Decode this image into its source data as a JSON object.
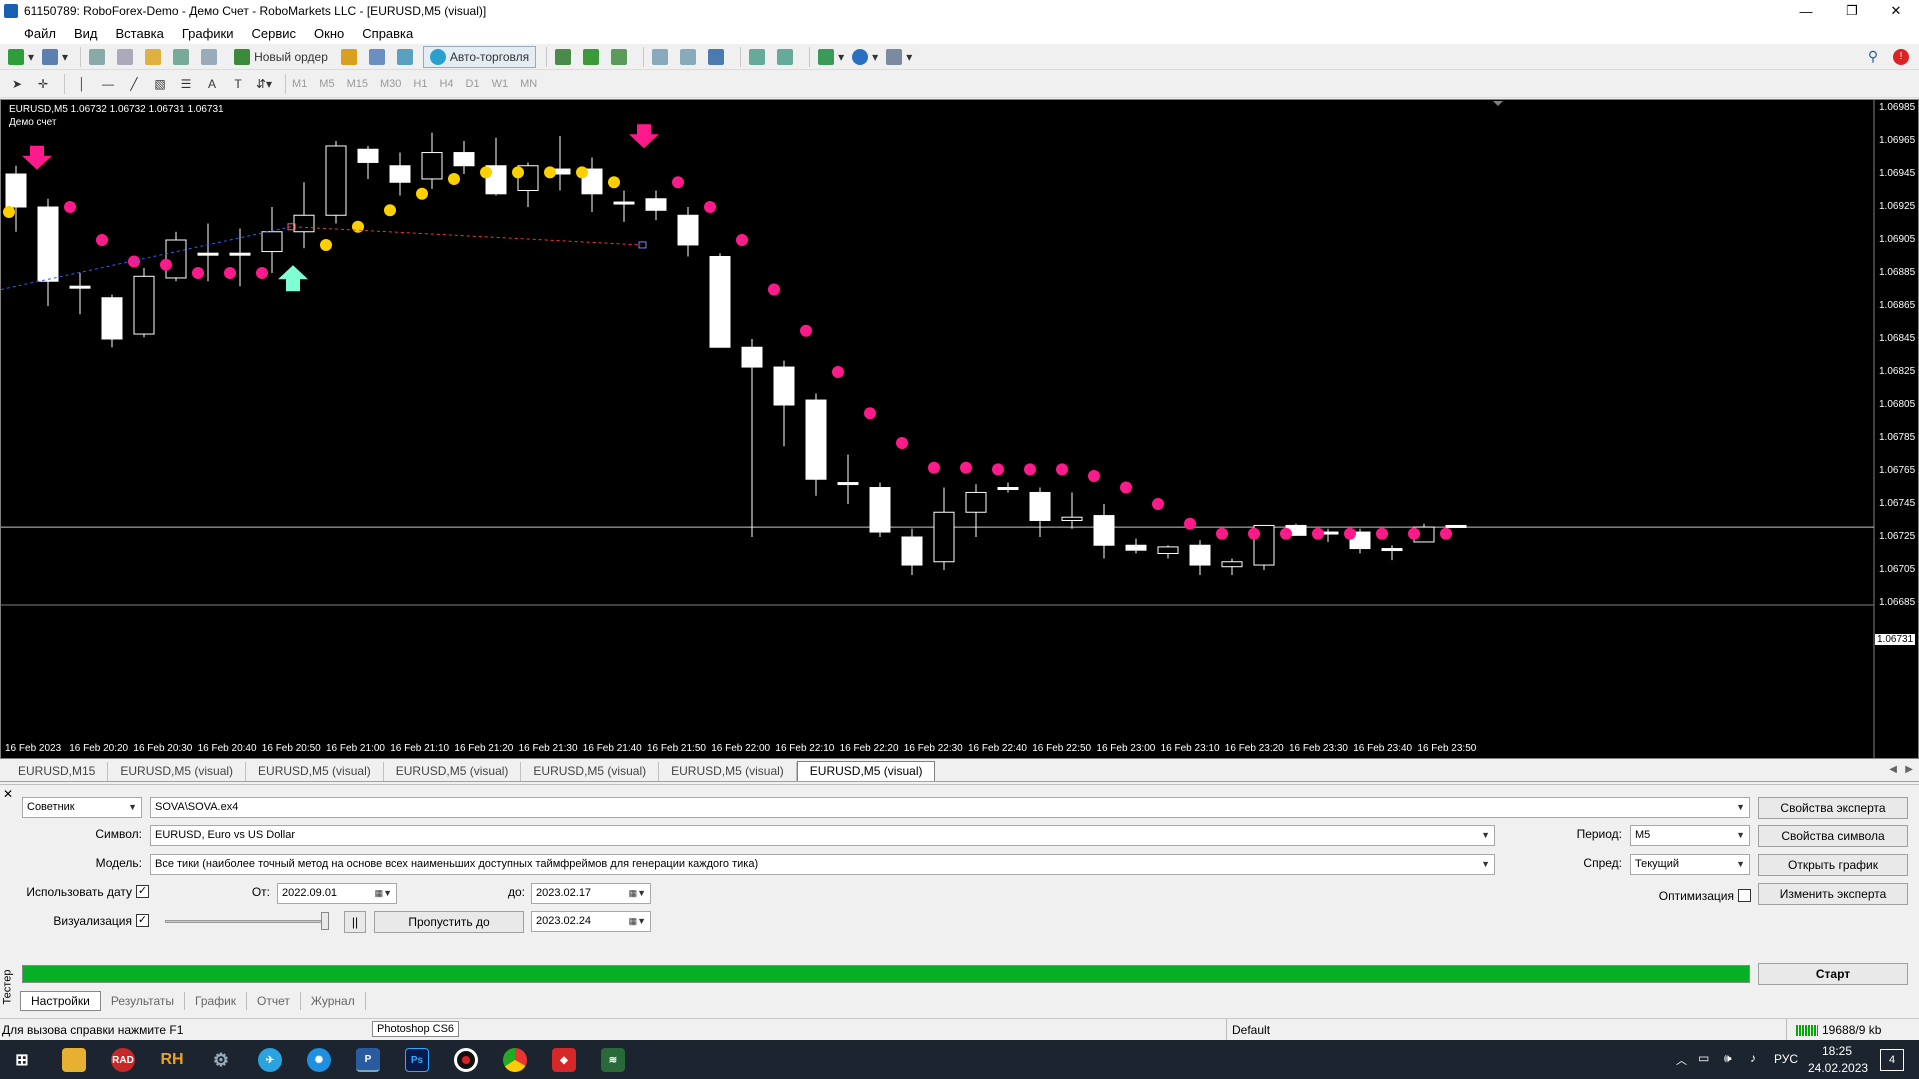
{
  "window": {
    "title": "61150789: RoboForex-Demo - Демо Счет - RoboMarkets LLC - [EURUSD,M5 (visual)]"
  },
  "menu": [
    "Файл",
    "Вид",
    "Вставка",
    "Графики",
    "Сервис",
    "Окно",
    "Справка"
  ],
  "toolbar": {
    "new_order": "Новый ордер",
    "auto_trading": "Авто-торговля"
  },
  "timeframes": [
    "M1",
    "M5",
    "M15",
    "M30",
    "H1",
    "H4",
    "D1",
    "W1",
    "MN"
  ],
  "chart": {
    "symbol_info": "EURUSD,M5  1.06732 1.06732 1.06731 1.06731",
    "account": "Демо счет",
    "current_price_label": "1.06731",
    "price_levels": [
      "1.06985",
      "1.06965",
      "1.06945",
      "1.06925",
      "1.06905",
      "1.06885",
      "1.06865",
      "1.06845",
      "1.06825",
      "1.06805",
      "1.06785",
      "1.06765",
      "1.06745",
      "1.06725",
      "1.06705",
      "1.06685"
    ],
    "time_labels": [
      "16 Feb 2023",
      "16 Feb 20:20",
      "16 Feb 20:30",
      "16 Feb 20:40",
      "16 Feb 20:50",
      "16 Feb 21:00",
      "16 Feb 21:10",
      "16 Feb 21:20",
      "16 Feb 21:30",
      "16 Feb 21:40",
      "16 Feb 21:50",
      "16 Feb 22:00",
      "16 Feb 22:10",
      "16 Feb 22:20",
      "16 Feb 22:30",
      "16 Feb 22:40",
      "16 Feb 22:50",
      "16 Feb 23:00",
      "16 Feb 23:10",
      "16 Feb 23:20",
      "16 Feb 23:30",
      "16 Feb 23:40",
      "16 Feb 23:50"
    ],
    "colors": {
      "background": "#000000",
      "candle": "#ffffff",
      "dot_pink": "#ff1a8c",
      "dot_yellow": "#ffd000",
      "arrow_up": "#7fffd4",
      "arrow_down": "#ff1a8c"
    }
  },
  "chart_tabs": [
    "EURUSD,M15",
    "EURUSD,M5 (visual)",
    "EURUSD,M5 (visual)",
    "EURUSD,M5 (visual)",
    "EURUSD,M5 (visual)",
    "EURUSD,M5 (visual)",
    "EURUSD,M5 (visual)"
  ],
  "tester": {
    "type": "Советник",
    "expert": "SOVA\\SOVA.ex4",
    "symbol_label": "Символ:",
    "symbol": "EURUSD, Euro vs US Dollar",
    "model_label": "Модель:",
    "model": "Все тики (наиболее точный метод на основе всех наименьших доступных таймфреймов для генерации каждого тика)",
    "use_date_label": "Использовать дату",
    "from_label": "От:",
    "from": "2022.09.01",
    "to_label": "до:",
    "to": "2023.02.17",
    "visual_label": "Визуализация",
    "skip_to_btn": "Пропустить до",
    "skip_to": "2023.02.24",
    "period_label": "Период:",
    "period": "M5",
    "spread_label": "Спред:",
    "spread": "Текущий",
    "optimization_label": "Оптимизация",
    "expert_props_btn": "Свойства эксперта",
    "symbol_props_btn": "Свойства символа",
    "open_chart_btn": "Открыть график",
    "modify_expert_btn": "Изменить эксперта",
    "start_btn": "Старт",
    "side_label": "Тестер",
    "pause_glyph": "||",
    "check_mark": "✓"
  },
  "bottom_tabs": [
    "Настройки",
    "Результаты",
    "График",
    "Отчет",
    "Журнал"
  ],
  "status": {
    "help": "Для вызова справки нажмите F1",
    "tooltip": "Photoshop CS6",
    "profile": "Default",
    "traffic": "19688/9 kb"
  },
  "taskbar": {
    "lang": "РУС",
    "time": "18:25",
    "date": "24.02.2023",
    "notifications": "4",
    "rad": "RAD",
    "rh": "RH",
    "ps": "Ps"
  }
}
